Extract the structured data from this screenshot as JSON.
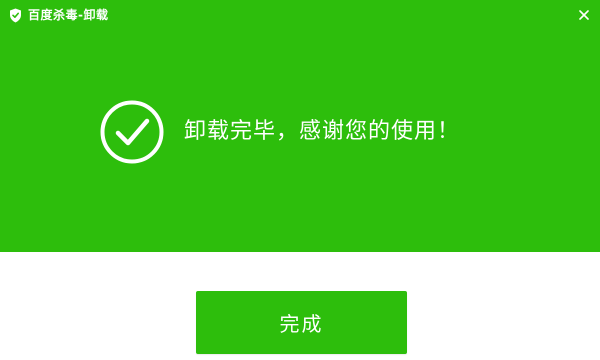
{
  "window": {
    "title": "百度杀毒-卸载",
    "brand_color": "#2dbe0c",
    "background": "#ffffff"
  },
  "titlebar": {
    "logo_icon": "shield-icon",
    "close_icon": "close-icon"
  },
  "status": {
    "icon": "check-circle-icon",
    "message": "卸载完毕，感谢您的使用！"
  },
  "actions": {
    "finish_label": "完成"
  }
}
